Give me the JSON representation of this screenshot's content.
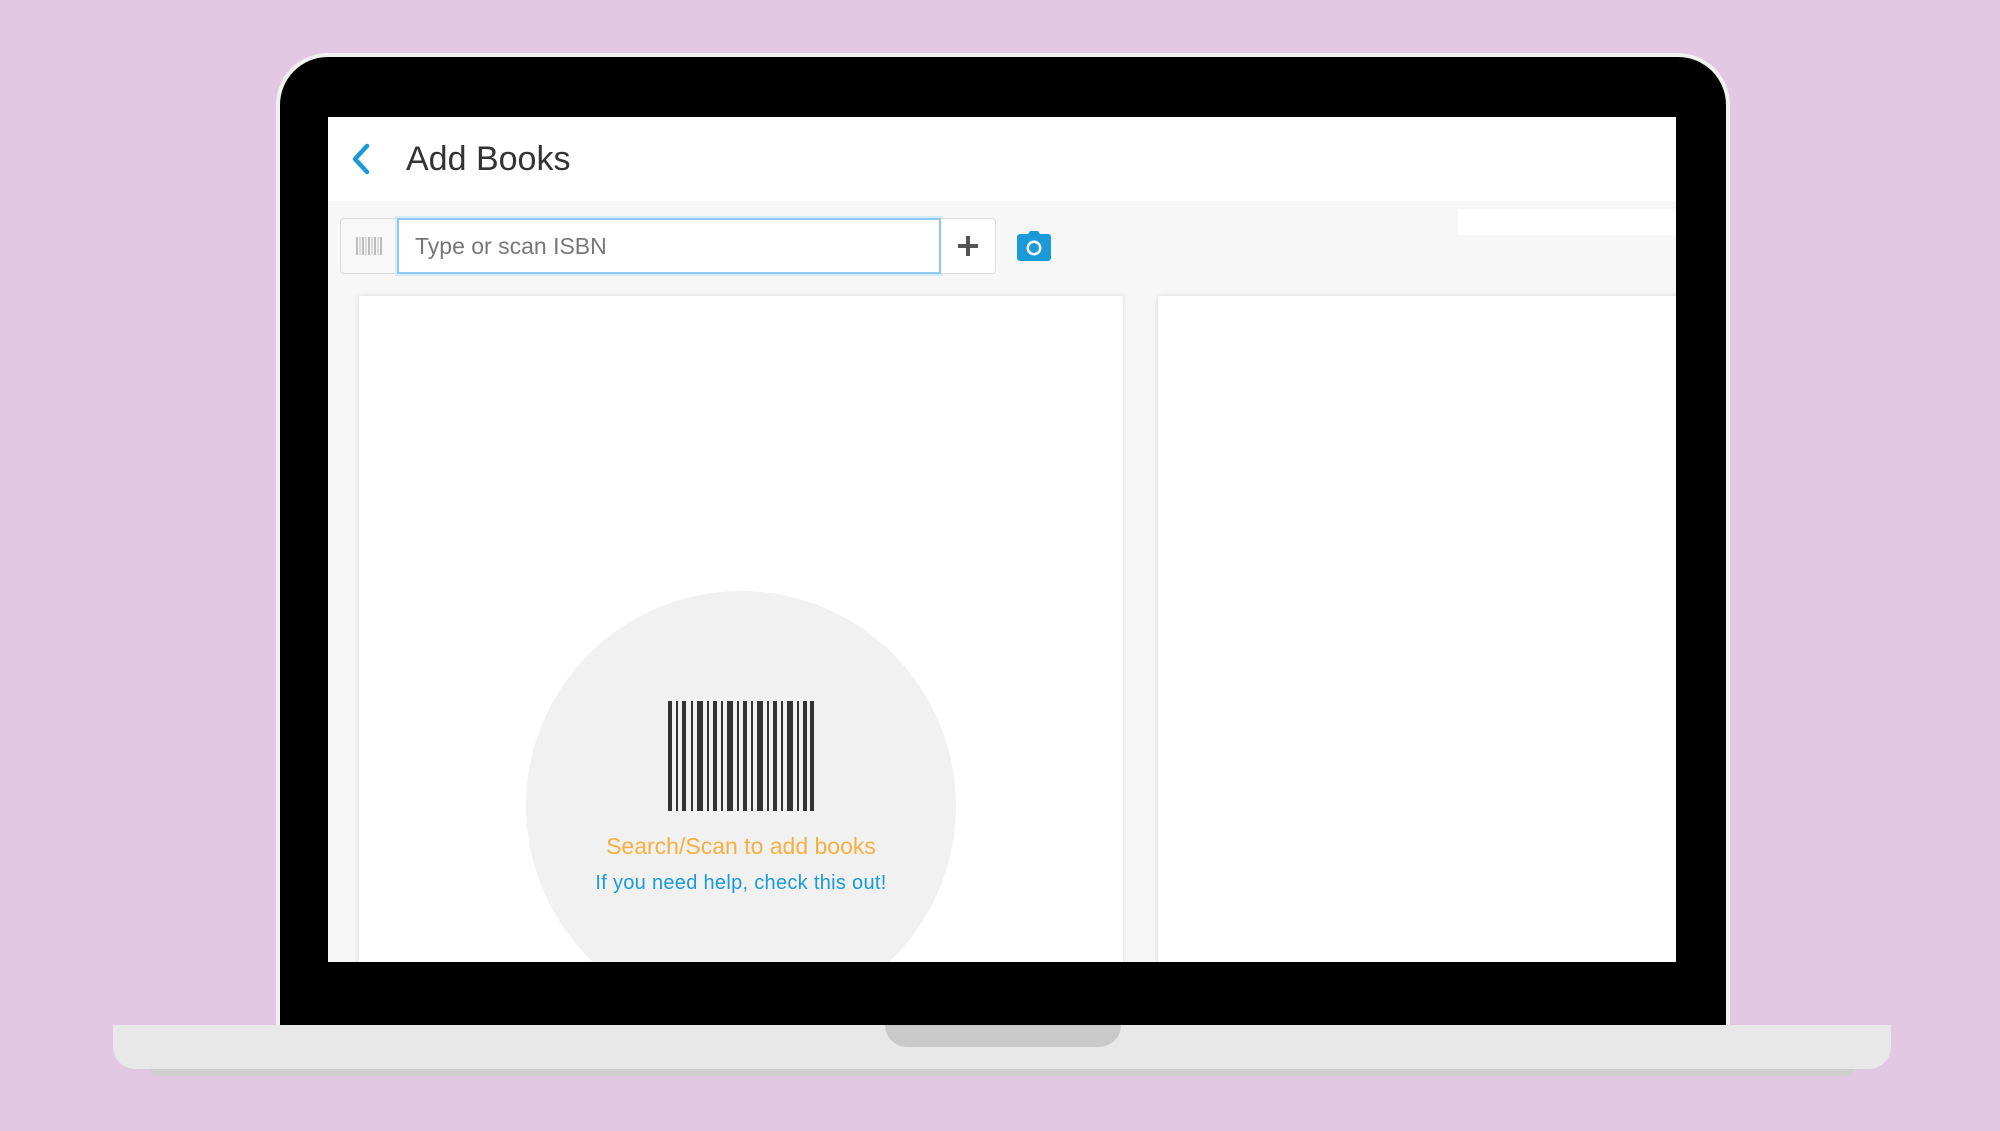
{
  "header": {
    "title": "Add Books",
    "back_icon": "chevron-left-icon"
  },
  "search": {
    "placeholder": "Type or scan ISBN",
    "value": "",
    "barcode_icon": "barcode-icon",
    "add_icon": "plus-icon",
    "camera_icon": "camera-icon"
  },
  "empty_state": {
    "title": "Search/Scan to add books",
    "help_link": "If you need help, check this out!",
    "illustration_icon": "barcode-icon"
  },
  "colors": {
    "accent": "#1a9ad6",
    "empty_title": "#f5b041",
    "background": "#e2c8e2"
  }
}
